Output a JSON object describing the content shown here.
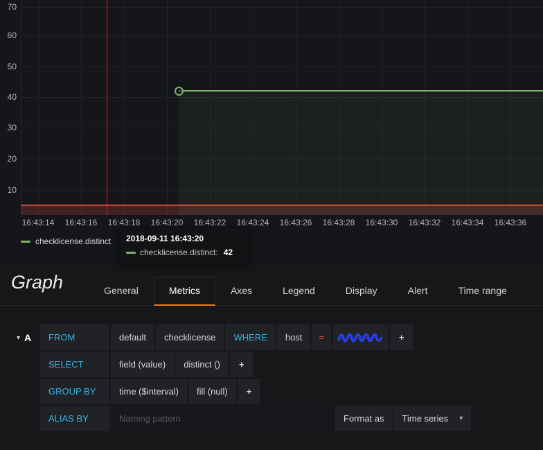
{
  "icons": {
    "caret_down": "▾",
    "plus": "+"
  },
  "colors": {
    "series_green": "#7eb26d",
    "threshold_red": "#e24d42",
    "accent_orange": "#eb7b18",
    "keyword_blue": "#33b5e5",
    "scribble_blue": "#2a46e8"
  },
  "chart_data": {
    "type": "line",
    "title": "",
    "series": [
      {
        "name": "checklicense.distinct",
        "color": "#7eb26d",
        "points": [
          [
            "16:43:20",
            42
          ],
          [
            "16:43:37",
            42
          ]
        ]
      }
    ],
    "ylim": [
      0,
      70
    ],
    "y_ticks": [
      10,
      20,
      30,
      40,
      50,
      60,
      70
    ],
    "x_ticks": [
      "16:43:14",
      "16:43:16",
      "16:43:18",
      "16:43:20",
      "16:43:22",
      "16:43:24",
      "16:43:26",
      "16:43:28",
      "16:43:30",
      "16:43:32",
      "16:43:34",
      "16:43:36"
    ],
    "threshold": {
      "value": 5,
      "color": "#e24d42"
    },
    "grid": true,
    "legend_position": "bottom-left"
  },
  "graph": {
    "y_ticks": [
      "70",
      "60",
      "50",
      "40",
      "30",
      "20",
      "10"
    ],
    "x_ticks": [
      "16:43:14",
      "16:43:16",
      "16:43:18",
      "16:43:20",
      "16:43:22",
      "16:43:24",
      "16:43:26",
      "16:43:28",
      "16:43:30",
      "16:43:32",
      "16:43:34",
      "16:43:36"
    ],
    "legend_label": "checklicense.distinct",
    "tooltip": {
      "timestamp": "2018-09-11 16:43:20",
      "series_label": "checklicense.distinct:",
      "value": "42"
    }
  },
  "editor": {
    "panel_title": "Graph",
    "tabs": [
      {
        "label": "General",
        "active": false
      },
      {
        "label": "Metrics",
        "active": true
      },
      {
        "label": "Axes",
        "active": false
      },
      {
        "label": "Legend",
        "active": false
      },
      {
        "label": "Display",
        "active": false
      },
      {
        "label": "Alert",
        "active": false
      },
      {
        "label": "Time range",
        "active": false
      }
    ],
    "query": {
      "letter": "A",
      "rows": {
        "from": {
          "keyword": "FROM",
          "policy": "default",
          "measurement": "checklicense",
          "where_keyword": "WHERE",
          "tag_key": "host",
          "operator": "="
        },
        "select": {
          "keyword": "SELECT",
          "field": "field (value)",
          "func": "distinct ()"
        },
        "group_by": {
          "keyword": "GROUP BY",
          "time": "time ($interval)",
          "fill": "fill (null)"
        },
        "alias": {
          "keyword": "ALIAS BY",
          "placeholder": "Naming pattern",
          "format_label": "Format as",
          "format_value": "Time series"
        }
      }
    }
  }
}
